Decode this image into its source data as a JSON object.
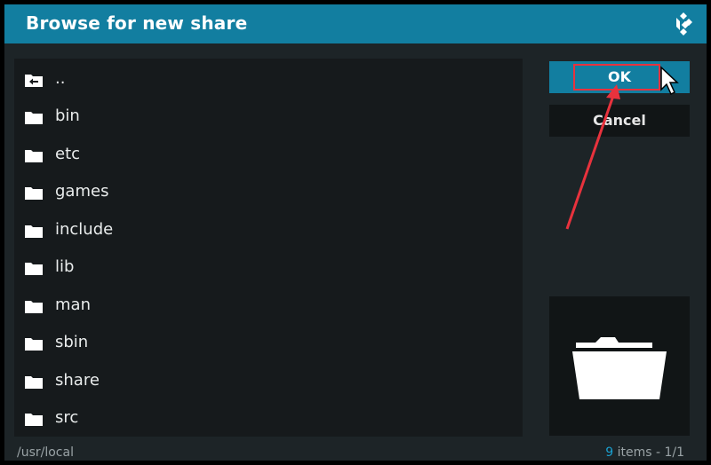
{
  "dialog": {
    "title": "Browse for new share",
    "logo_icon": "kodi-logo-icon"
  },
  "file_list": {
    "items": [
      {
        "label": "..",
        "icon": "folder-back-icon"
      },
      {
        "label": "bin",
        "icon": "folder-icon"
      },
      {
        "label": "etc",
        "icon": "folder-icon"
      },
      {
        "label": "games",
        "icon": "folder-icon"
      },
      {
        "label": "include",
        "icon": "folder-icon"
      },
      {
        "label": "lib",
        "icon": "folder-icon"
      },
      {
        "label": "man",
        "icon": "folder-icon"
      },
      {
        "label": "sbin",
        "icon": "folder-icon"
      },
      {
        "label": "share",
        "icon": "folder-icon"
      },
      {
        "label": "src",
        "icon": "folder-icon"
      }
    ]
  },
  "buttons": {
    "ok_label": "OK",
    "cancel_label": "Cancel"
  },
  "preview": {
    "icon": "folder-large-icon"
  },
  "footer": {
    "path": "/usr/local",
    "count_number": "9",
    "count_suffix": " items - ",
    "page": "1/1"
  },
  "colors": {
    "accent": "#127ea0",
    "highlight": "#e8323d"
  }
}
